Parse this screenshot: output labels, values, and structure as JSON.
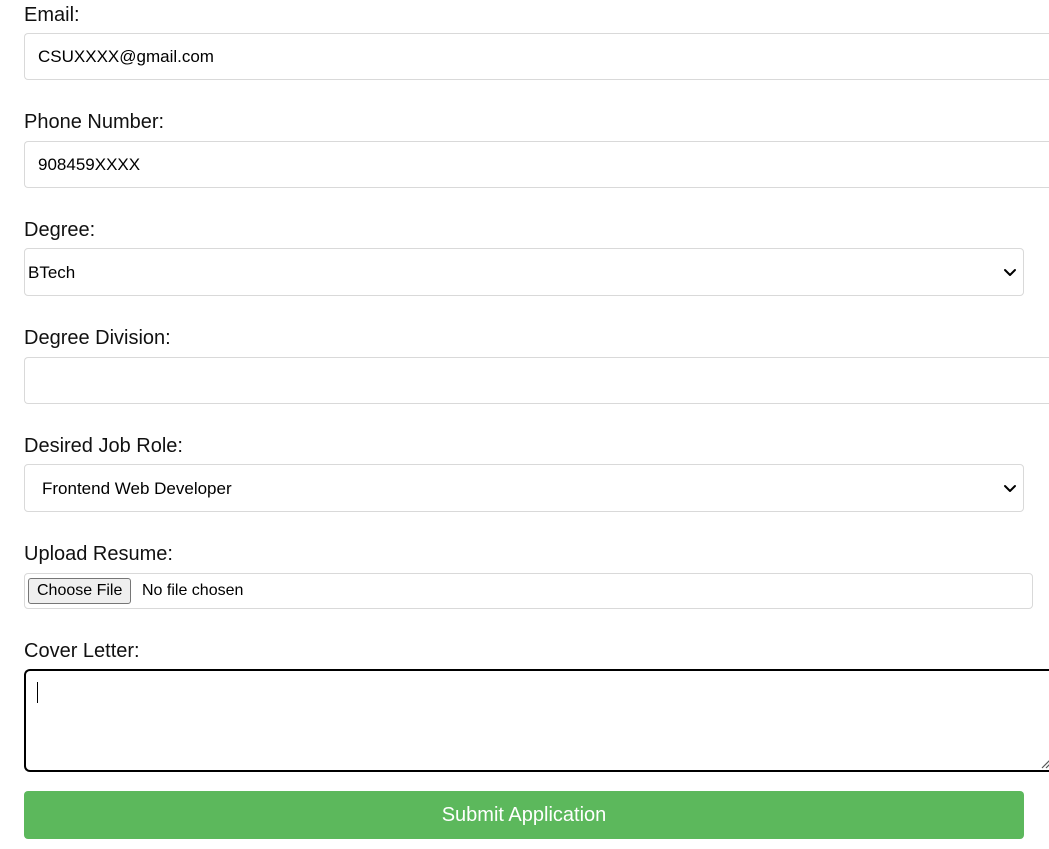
{
  "form": {
    "email": {
      "label": "Email:",
      "value": "CSUXXXX@gmail.com"
    },
    "phone": {
      "label": "Phone Number:",
      "value": "908459XXXX"
    },
    "degree": {
      "label": "Degree:",
      "selected": "BTech"
    },
    "degree_division": {
      "label": "Degree Division:",
      "value": ""
    },
    "job_role": {
      "label": "Desired Job Role:",
      "selected": "Frontend Web Developer"
    },
    "resume": {
      "label": "Upload Resume:",
      "button_label": "Choose File",
      "status": "No file chosen"
    },
    "cover_letter": {
      "label": "Cover Letter:",
      "value": ""
    },
    "submit_label": "Submit Application"
  },
  "colors": {
    "submit_background": "#5cb85c",
    "submit_text": "#ffffff",
    "field_border": "#d9d9d9",
    "focused_border": "#000000"
  },
  "icons": {
    "select_arrow": "chevron-down-icon",
    "textarea_resize": "resize-handle-icon"
  }
}
